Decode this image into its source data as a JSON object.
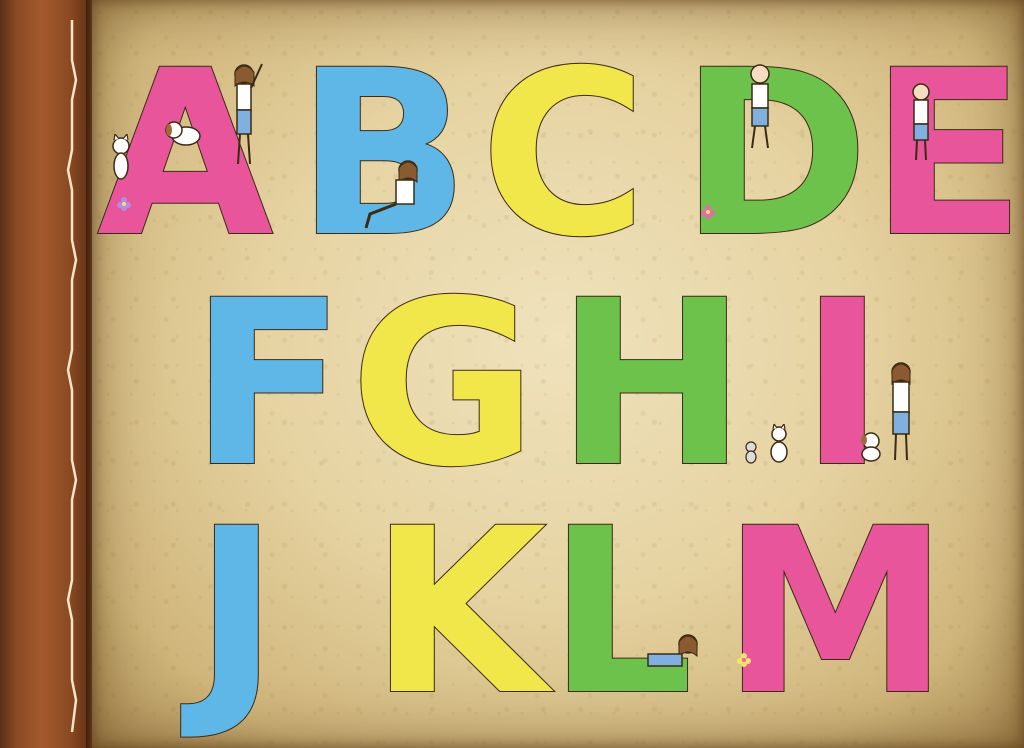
{
  "book": {
    "colors": {
      "pink": "#e8559a",
      "blue": "#5fb7e8",
      "yellow": "#f2e74a",
      "green": "#6cc24a",
      "leather": "#a35a2c",
      "parchment": "#e6d3a2"
    },
    "letters": [
      {
        "char": "A",
        "color": "pink"
      },
      {
        "char": "B",
        "color": "blue"
      },
      {
        "char": "C",
        "color": "yellow"
      },
      {
        "char": "D",
        "color": "green"
      },
      {
        "char": "E",
        "color": "pink"
      },
      {
        "char": "F",
        "color": "blue"
      },
      {
        "char": "G",
        "color": "yellow"
      },
      {
        "char": "H",
        "color": "green"
      },
      {
        "char": "I",
        "color": "pink"
      },
      {
        "char": "J",
        "color": "blue"
      },
      {
        "char": "K",
        "color": "yellow"
      },
      {
        "char": "L",
        "color": "green"
      },
      {
        "char": "M",
        "color": "pink"
      }
    ],
    "illustrations": [
      "girl-character-icon",
      "dog-character-icon",
      "cat-character-icon",
      "mouse-character-icon",
      "flower-icon"
    ]
  }
}
